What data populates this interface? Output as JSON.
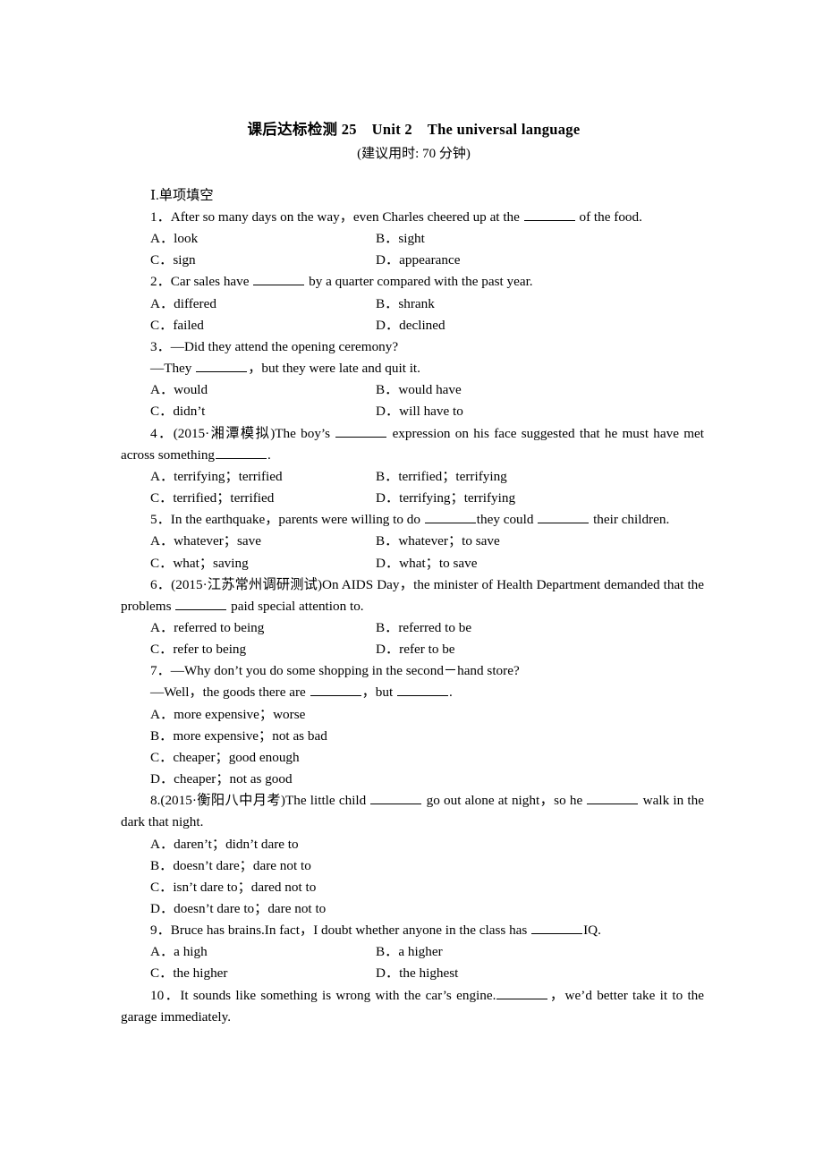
{
  "header": {
    "title": "课后达标检测 25 Unit 2 The universal language",
    "subtitle": "(建议用时: 70 分钟)"
  },
  "section": {
    "heading": "Ⅰ.单项填空"
  },
  "questions": [
    {
      "number": "1",
      "stem_prefix": "1．After so many days on the way，even Charles cheered up at the ",
      "stem_suffix": " of the food.",
      "layout": "two-col",
      "options": [
        "A．look",
        "B．sight",
        "C．sign",
        "D．appearance"
      ]
    },
    {
      "number": "2",
      "stem_prefix": "2．Car sales have ",
      "stem_suffix": " by a quarter compared with the past year.",
      "layout": "two-col",
      "options": [
        "A．differed",
        "B．shrank",
        "C．failed",
        "D．declined"
      ]
    },
    {
      "number": "3",
      "stem_prefix": "3．—Did they attend the opening ceremony?",
      "stem_suffix": "",
      "cont_prefix": "—They ",
      "cont_suffix": "，but they were late and quit it.",
      "layout": "two-col",
      "options": [
        "A．would",
        "B．would have",
        "C．didn’t",
        "D．will have to"
      ]
    },
    {
      "number": "4",
      "stem_prefix": "4．(2015·湘潭模拟)The boy’s ",
      "stem_mid": " expression on his face suggested that he must have met across something",
      "stem_suffix": ".",
      "layout": "two-col",
      "options": [
        "A．terrifying；terrified",
        "B．terrified；terrifying",
        "C．terrified；terrified",
        "D．terrifying；terrifying"
      ]
    },
    {
      "number": "5",
      "stem_prefix": "5．In the earthquake，parents were willing to do ",
      "stem_mid": "they could ",
      "stem_suffix": " their children.",
      "layout": "two-col",
      "options": [
        "A．whatever；save",
        "B．whatever；to save",
        "C．what；saving",
        "D．what；to save"
      ]
    },
    {
      "number": "6",
      "stem_prefix": "6．(2015·江苏常州调研测试)On AIDS Day，the minister of Health Department demanded that the problems ",
      "stem_suffix": " paid special attention to.",
      "layout": "two-col",
      "options": [
        "A．referred to being",
        "B．referred to be",
        "C．refer to being",
        "D．refer to be"
      ]
    },
    {
      "number": "7",
      "stem_prefix": "7．—Why don’t you do some shopping in the second－hand store?",
      "stem_suffix": "",
      "cont_prefix": "—Well，the goods there are ",
      "cont_mid": "，but ",
      "cont_suffix": ".",
      "layout": "single-col",
      "options": [
        "A．more expensive；worse",
        "B．more expensive；not as bad",
        "C．cheaper；good enough",
        "D．cheaper；not as good"
      ]
    },
    {
      "number": "8",
      "stem_prefix": "8.(2015·衡阳八中月考)The little child ",
      "stem_mid": " go out alone at night，so he ",
      "stem_suffix": " walk in the dark that night.",
      "layout": "single-col",
      "options": [
        "A．daren’t；didn’t dare to",
        "B．doesn’t dare；dare not to",
        "C．isn’t dare to；dared not to",
        "D．doesn’t dare to；dare not to"
      ]
    },
    {
      "number": "9",
      "stem_prefix": "9．Bruce has brains.In fact，I doubt whether anyone in the class has ",
      "stem_suffix": "IQ.",
      "layout": "two-col",
      "options": [
        "A．a high",
        "B．a higher",
        "C．the higher",
        "D．the highest"
      ]
    },
    {
      "number": "10",
      "stem_prefix": "10．It sounds like something is wrong with the car’s engine.",
      "stem_suffix": "，we’d better take it to the garage immediately.",
      "layout": "none",
      "options": []
    }
  ]
}
